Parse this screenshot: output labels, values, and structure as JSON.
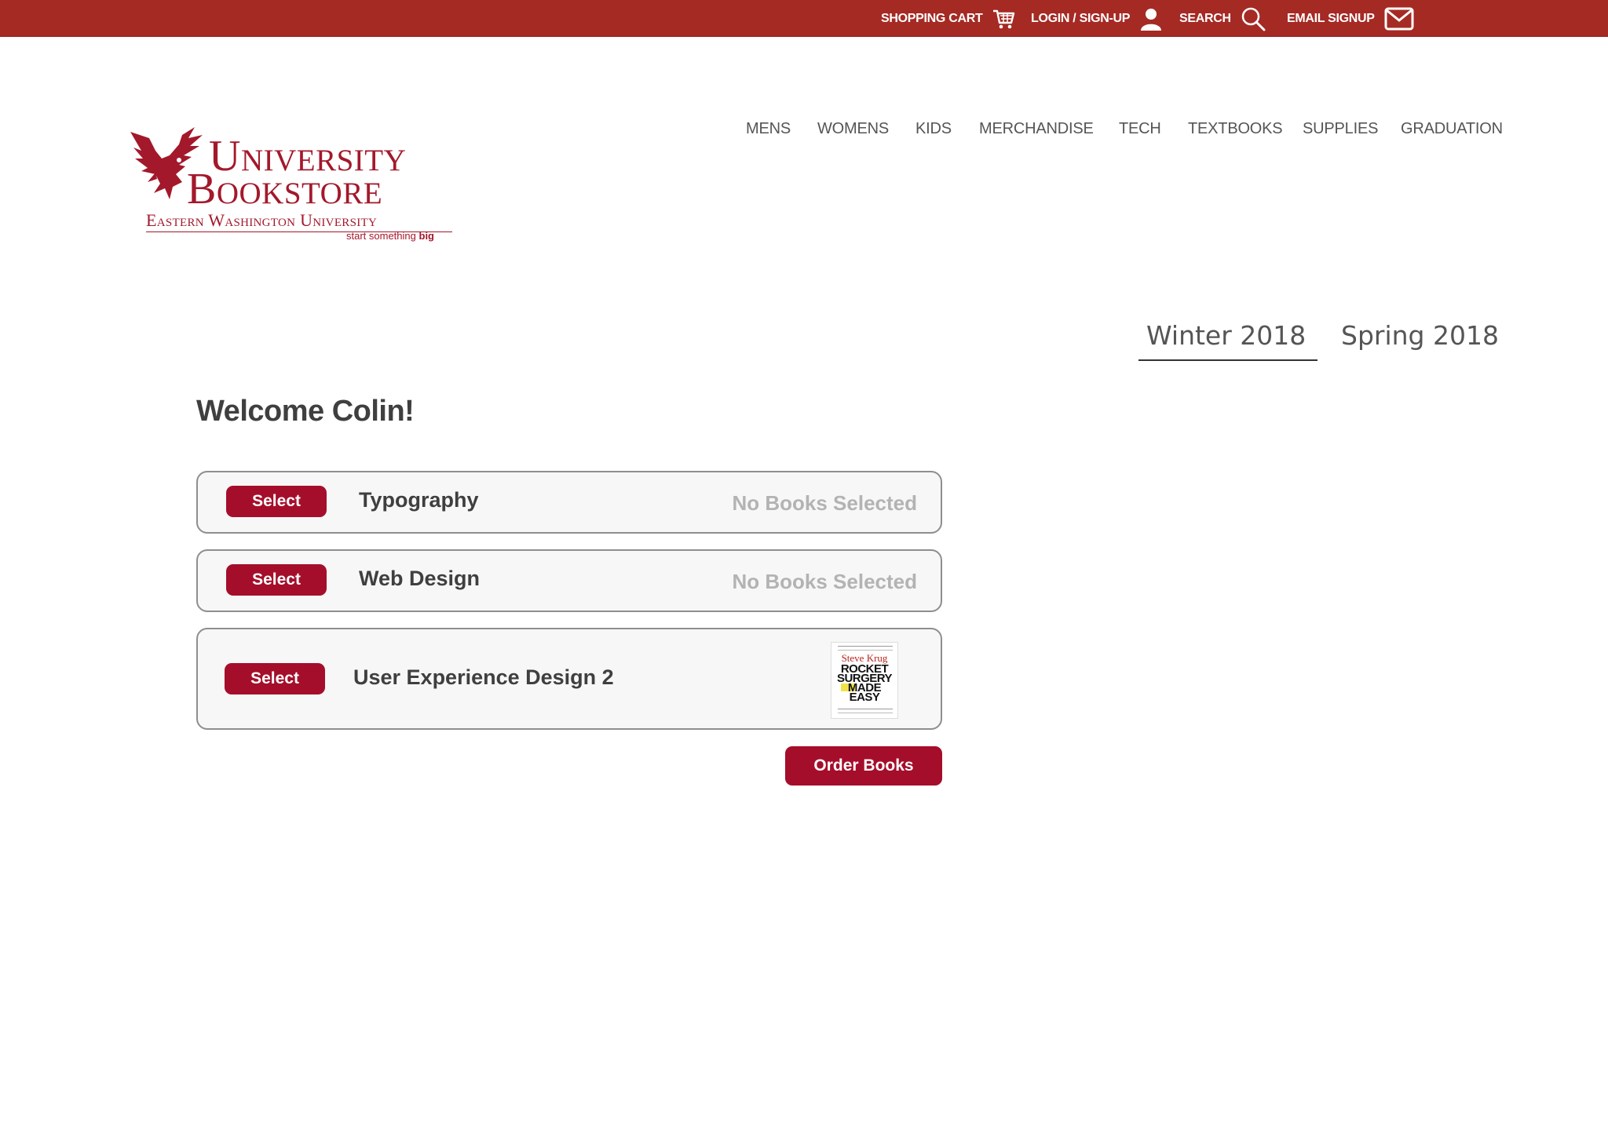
{
  "topbar": {
    "background": "#a52a24",
    "cart_label": "SHOPPING CART",
    "cart_icon": "shopping-cart-icon",
    "login_label": "LOGIN / SIGN-UP",
    "login_icon": "user-icon",
    "search_label": "SEARCH",
    "search_icon": "search-icon",
    "email_label": "EMAIL SIGNUP",
    "email_icon": "envelope-icon"
  },
  "logo": {
    "line1": "University",
    "line2": "Bookstore",
    "line3": "Eastern Washington University",
    "tagline_prefix": "start something ",
    "tagline_bold": "big",
    "icon": "eagle-icon",
    "color": "#a3182b"
  },
  "nav": {
    "items": [
      "MENS",
      "WOMENS",
      "KIDS",
      "MERCHANDISE",
      "TECH",
      "TEXTBOOKS",
      "SUPPLIES",
      "GRADUATION"
    ]
  },
  "terms": {
    "active": "Winter 2018",
    "other": "Spring 2018"
  },
  "welcome": "Welcome Colin!",
  "courses": [
    {
      "select_label": "Select",
      "name": "Typography",
      "status": "No Books Selected"
    },
    {
      "select_label": "Select",
      "name": "Web Design",
      "status": "No Books Selected"
    },
    {
      "select_label": "Select",
      "name": "User Experience Design 2",
      "book": {
        "author": "Steve Krug",
        "title_lines": [
          "ROCKET",
          "SURGERY",
          "MADE",
          "EASY"
        ]
      }
    }
  ],
  "order_button": "Order Books",
  "accent": "#a50e2a"
}
